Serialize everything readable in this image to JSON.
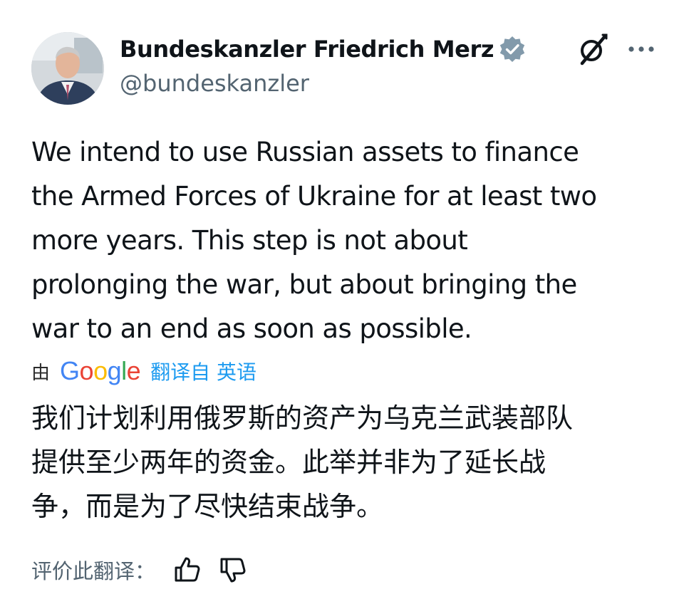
{
  "author": {
    "display_name": "Bundeskanzler Friedrich Merz",
    "handle": "@bundeskanzler",
    "verified": true,
    "verified_color": "#829aab"
  },
  "header_actions": {
    "grok_icon": "grok-icon",
    "more_icon": "more-horizontal-icon"
  },
  "tweet": {
    "lines": [
      "We intend to use Russian assets to finance",
      "the Armed Forces of Ukraine for at least two",
      "more years. This step is not about",
      "prolonging the war, but about bringing the",
      "war to an end as soon as possible."
    ]
  },
  "translation": {
    "by_label": "由",
    "provider": "Google",
    "translated_from": "翻译自 英语",
    "link_color": "#1d9bf0",
    "lines": [
      "我们计划利用俄罗斯的资产为乌克兰武装部队",
      "提供至少两年的资金。此举并非为了延长战",
      "争，而是为了尽快结束战争。"
    ]
  },
  "rating": {
    "label": "评价此翻译：",
    "thumbs_up_icon": "thumbs-up-icon",
    "thumbs_down_icon": "thumbs-down-icon"
  }
}
